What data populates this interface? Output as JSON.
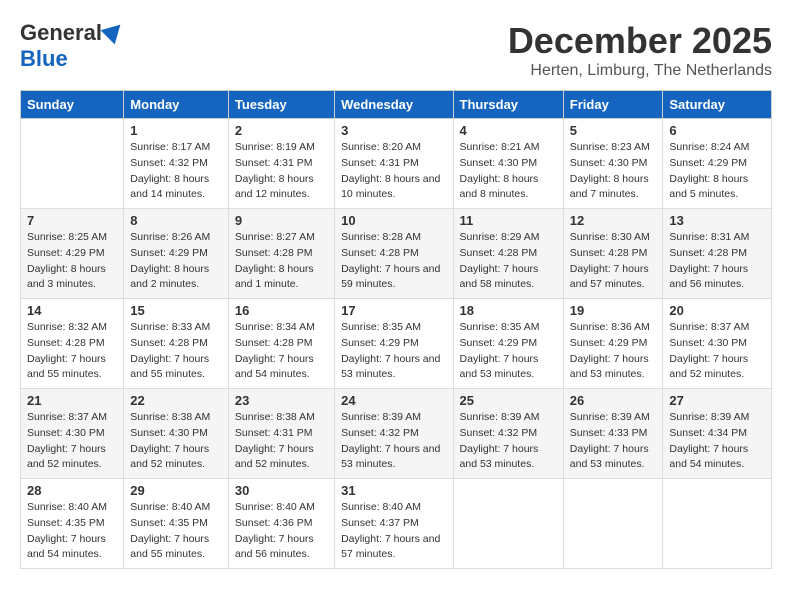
{
  "header": {
    "logo_general": "General",
    "logo_blue": "Blue",
    "month_title": "December 2025",
    "location": "Herten, Limburg, The Netherlands"
  },
  "days_of_week": [
    "Sunday",
    "Monday",
    "Tuesday",
    "Wednesday",
    "Thursday",
    "Friday",
    "Saturday"
  ],
  "weeks": [
    [
      {
        "num": "",
        "sunrise": "",
        "sunset": "",
        "daylight": ""
      },
      {
        "num": "1",
        "sunrise": "Sunrise: 8:17 AM",
        "sunset": "Sunset: 4:32 PM",
        "daylight": "Daylight: 8 hours and 14 minutes."
      },
      {
        "num": "2",
        "sunrise": "Sunrise: 8:19 AM",
        "sunset": "Sunset: 4:31 PM",
        "daylight": "Daylight: 8 hours and 12 minutes."
      },
      {
        "num": "3",
        "sunrise": "Sunrise: 8:20 AM",
        "sunset": "Sunset: 4:31 PM",
        "daylight": "Daylight: 8 hours and 10 minutes."
      },
      {
        "num": "4",
        "sunrise": "Sunrise: 8:21 AM",
        "sunset": "Sunset: 4:30 PM",
        "daylight": "Daylight: 8 hours and 8 minutes."
      },
      {
        "num": "5",
        "sunrise": "Sunrise: 8:23 AM",
        "sunset": "Sunset: 4:30 PM",
        "daylight": "Daylight: 8 hours and 7 minutes."
      },
      {
        "num": "6",
        "sunrise": "Sunrise: 8:24 AM",
        "sunset": "Sunset: 4:29 PM",
        "daylight": "Daylight: 8 hours and 5 minutes."
      }
    ],
    [
      {
        "num": "7",
        "sunrise": "Sunrise: 8:25 AM",
        "sunset": "Sunset: 4:29 PM",
        "daylight": "Daylight: 8 hours and 3 minutes."
      },
      {
        "num": "8",
        "sunrise": "Sunrise: 8:26 AM",
        "sunset": "Sunset: 4:29 PM",
        "daylight": "Daylight: 8 hours and 2 minutes."
      },
      {
        "num": "9",
        "sunrise": "Sunrise: 8:27 AM",
        "sunset": "Sunset: 4:28 PM",
        "daylight": "Daylight: 8 hours and 1 minute."
      },
      {
        "num": "10",
        "sunrise": "Sunrise: 8:28 AM",
        "sunset": "Sunset: 4:28 PM",
        "daylight": "Daylight: 7 hours and 59 minutes."
      },
      {
        "num": "11",
        "sunrise": "Sunrise: 8:29 AM",
        "sunset": "Sunset: 4:28 PM",
        "daylight": "Daylight: 7 hours and 58 minutes."
      },
      {
        "num": "12",
        "sunrise": "Sunrise: 8:30 AM",
        "sunset": "Sunset: 4:28 PM",
        "daylight": "Daylight: 7 hours and 57 minutes."
      },
      {
        "num": "13",
        "sunrise": "Sunrise: 8:31 AM",
        "sunset": "Sunset: 4:28 PM",
        "daylight": "Daylight: 7 hours and 56 minutes."
      }
    ],
    [
      {
        "num": "14",
        "sunrise": "Sunrise: 8:32 AM",
        "sunset": "Sunset: 4:28 PM",
        "daylight": "Daylight: 7 hours and 55 minutes."
      },
      {
        "num": "15",
        "sunrise": "Sunrise: 8:33 AM",
        "sunset": "Sunset: 4:28 PM",
        "daylight": "Daylight: 7 hours and 55 minutes."
      },
      {
        "num": "16",
        "sunrise": "Sunrise: 8:34 AM",
        "sunset": "Sunset: 4:28 PM",
        "daylight": "Daylight: 7 hours and 54 minutes."
      },
      {
        "num": "17",
        "sunrise": "Sunrise: 8:35 AM",
        "sunset": "Sunset: 4:29 PM",
        "daylight": "Daylight: 7 hours and 53 minutes."
      },
      {
        "num": "18",
        "sunrise": "Sunrise: 8:35 AM",
        "sunset": "Sunset: 4:29 PM",
        "daylight": "Daylight: 7 hours and 53 minutes."
      },
      {
        "num": "19",
        "sunrise": "Sunrise: 8:36 AM",
        "sunset": "Sunset: 4:29 PM",
        "daylight": "Daylight: 7 hours and 53 minutes."
      },
      {
        "num": "20",
        "sunrise": "Sunrise: 8:37 AM",
        "sunset": "Sunset: 4:30 PM",
        "daylight": "Daylight: 7 hours and 52 minutes."
      }
    ],
    [
      {
        "num": "21",
        "sunrise": "Sunrise: 8:37 AM",
        "sunset": "Sunset: 4:30 PM",
        "daylight": "Daylight: 7 hours and 52 minutes."
      },
      {
        "num": "22",
        "sunrise": "Sunrise: 8:38 AM",
        "sunset": "Sunset: 4:30 PM",
        "daylight": "Daylight: 7 hours and 52 minutes."
      },
      {
        "num": "23",
        "sunrise": "Sunrise: 8:38 AM",
        "sunset": "Sunset: 4:31 PM",
        "daylight": "Daylight: 7 hours and 52 minutes."
      },
      {
        "num": "24",
        "sunrise": "Sunrise: 8:39 AM",
        "sunset": "Sunset: 4:32 PM",
        "daylight": "Daylight: 7 hours and 53 minutes."
      },
      {
        "num": "25",
        "sunrise": "Sunrise: 8:39 AM",
        "sunset": "Sunset: 4:32 PM",
        "daylight": "Daylight: 7 hours and 53 minutes."
      },
      {
        "num": "26",
        "sunrise": "Sunrise: 8:39 AM",
        "sunset": "Sunset: 4:33 PM",
        "daylight": "Daylight: 7 hours and 53 minutes."
      },
      {
        "num": "27",
        "sunrise": "Sunrise: 8:39 AM",
        "sunset": "Sunset: 4:34 PM",
        "daylight": "Daylight: 7 hours and 54 minutes."
      }
    ],
    [
      {
        "num": "28",
        "sunrise": "Sunrise: 8:40 AM",
        "sunset": "Sunset: 4:35 PM",
        "daylight": "Daylight: 7 hours and 54 minutes."
      },
      {
        "num": "29",
        "sunrise": "Sunrise: 8:40 AM",
        "sunset": "Sunset: 4:35 PM",
        "daylight": "Daylight: 7 hours and 55 minutes."
      },
      {
        "num": "30",
        "sunrise": "Sunrise: 8:40 AM",
        "sunset": "Sunset: 4:36 PM",
        "daylight": "Daylight: 7 hours and 56 minutes."
      },
      {
        "num": "31",
        "sunrise": "Sunrise: 8:40 AM",
        "sunset": "Sunset: 4:37 PM",
        "daylight": "Daylight: 7 hours and 57 minutes."
      },
      {
        "num": "",
        "sunrise": "",
        "sunset": "",
        "daylight": ""
      },
      {
        "num": "",
        "sunrise": "",
        "sunset": "",
        "daylight": ""
      },
      {
        "num": "",
        "sunrise": "",
        "sunset": "",
        "daylight": ""
      }
    ]
  ]
}
